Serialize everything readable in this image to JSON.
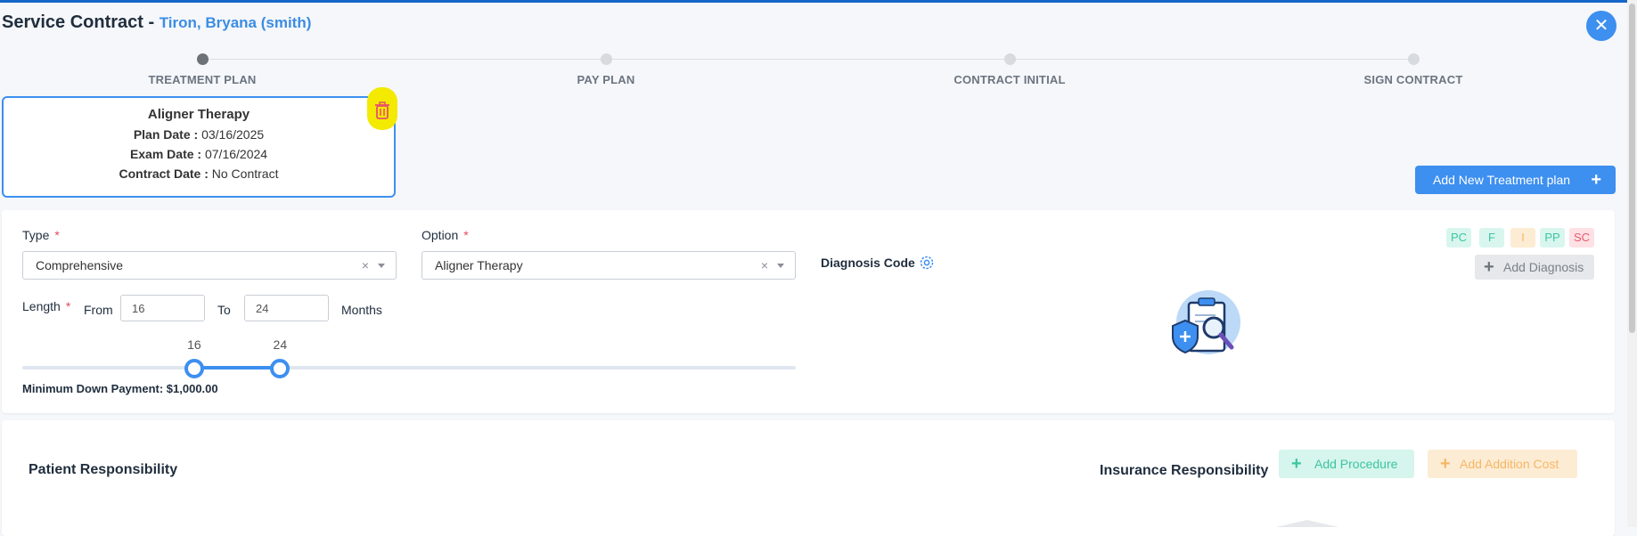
{
  "header": {
    "title": "Service Contract - ",
    "patient": "Tiron, Bryana (smith)",
    "close_icon": "close-icon"
  },
  "stepper": {
    "steps": [
      {
        "label": "TREATMENT PLAN",
        "active": true
      },
      {
        "label": "PAY PLAN",
        "active": false
      },
      {
        "label": "CONTRACT INITIAL",
        "active": false
      },
      {
        "label": "SIGN CONTRACT",
        "active": false
      }
    ]
  },
  "plan_card": {
    "name": "Aligner Therapy",
    "plan_date_label": "Plan Date :",
    "plan_date": "03/16/2025",
    "exam_date_label": "Exam Date :",
    "exam_date": "07/16/2024",
    "contract_date_label": "Contract Date :",
    "contract_date": "No Contract",
    "delete_icon": "trash-icon"
  },
  "add_plan_button": "Add New Treatment plan",
  "form": {
    "type_label": "Type",
    "type_value": "Comprehensive",
    "option_label": "Option",
    "option_value": "Aligner Therapy",
    "required_mark": "*",
    "length_label": "Length",
    "from_label": "From",
    "from_value": "16",
    "to_label": "To",
    "to_value": "24",
    "months_label": "Months",
    "slider": {
      "min": 0,
      "max": 72,
      "low": 16,
      "high": 24,
      "low_label": "16",
      "high_label": "24"
    },
    "min_down_payment": "Minimum Down Payment: $1,000.00",
    "clear_glyph": "×"
  },
  "diagnosis": {
    "label": "Diagnosis Code",
    "settings_icon": "gear-icon",
    "badges": [
      {
        "text": "PC",
        "bg": "#d8f6ee",
        "fg": "#3cc5a0"
      },
      {
        "text": "F",
        "bg": "#d8f6ee",
        "fg": "#3cc5a0"
      },
      {
        "text": "I",
        "bg": "#fdecd4",
        "fg": "#f5b766"
      },
      {
        "text": "PP",
        "bg": "#d8f6ee",
        "fg": "#3cc5a0"
      },
      {
        "text": "SC",
        "bg": "#fde1e4",
        "fg": "#e85a6d"
      }
    ],
    "add_button": "Add Diagnosis",
    "illustration": "clipboard-search-icon"
  },
  "responsibility": {
    "patient_title": "Patient Responsibility",
    "insurance_title": "Insurance Responsibility",
    "add_procedure": "Add Procedure",
    "add_cost": "Add Addition Cost"
  },
  "colors": {
    "accent": "#3d8ff0",
    "highlight": "#f3ea00"
  }
}
